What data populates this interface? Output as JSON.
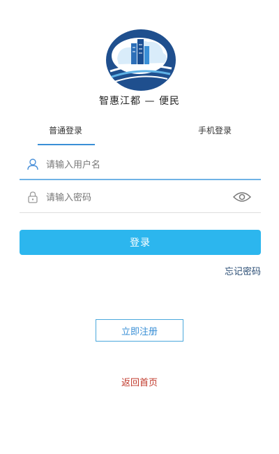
{
  "header": {
    "logo_icon": "city-cloud-logo",
    "title": "智惠江都 — 便民"
  },
  "tabs": [
    {
      "label": "普通登录",
      "active": true
    },
    {
      "label": "手机登录",
      "active": false
    }
  ],
  "form": {
    "username": {
      "placeholder": "请输入用户名",
      "value": "",
      "icon": "user-icon"
    },
    "password": {
      "placeholder": "请输入密码",
      "value": "",
      "icon": "lock-icon",
      "toggle_icon": "eye-icon"
    }
  },
  "buttons": {
    "login": "登录",
    "forgot": "忘记密码",
    "register": "立即注册",
    "back_home": "返回首页"
  },
  "colors": {
    "primary": "#2cb6ee",
    "accent": "#3a8fd6",
    "link_dark": "#2a4d74",
    "back_link": "#c0392b"
  }
}
